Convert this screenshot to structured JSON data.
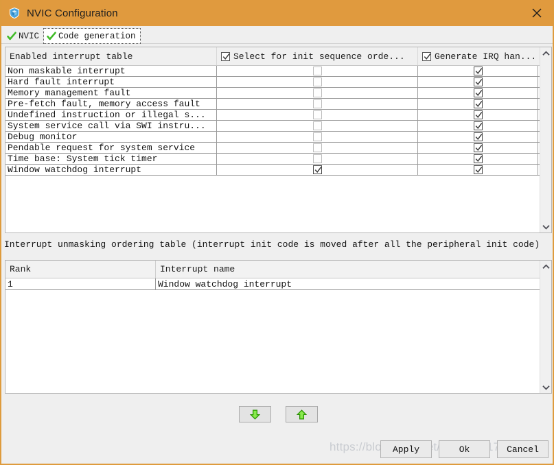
{
  "window": {
    "title": "NVIC Configuration",
    "icon": "shield-cube-icon",
    "close_label": "✕",
    "titlebar_color": "#e09a3e",
    "border_color": "#de9b3d"
  },
  "tabs": [
    {
      "label": "NVIC",
      "icon": "green-check-icon",
      "active": false
    },
    {
      "label": "Code generation",
      "icon": "green-check-icon",
      "active": true
    }
  ],
  "interrupt_table": {
    "columns": [
      {
        "key": "name",
        "label": "Enabled interrupt table",
        "has_checkbox": false
      },
      {
        "key": "select",
        "label": "Select for init sequence orde...",
        "has_checkbox": true,
        "checked": true
      },
      {
        "key": "irq",
        "label": "Generate IRQ han...",
        "has_checkbox": true,
        "checked": true
      }
    ],
    "rows": [
      {
        "name": "Non maskable interrupt",
        "select": false,
        "select_enabled": false,
        "irq": true
      },
      {
        "name": "Hard fault interrupt",
        "select": false,
        "select_enabled": false,
        "irq": true
      },
      {
        "name": "Memory management fault",
        "select": false,
        "select_enabled": false,
        "irq": true
      },
      {
        "name": "Pre-fetch fault, memory access fault",
        "select": false,
        "select_enabled": false,
        "irq": true
      },
      {
        "name": "Undefined instruction or illegal s...",
        "select": false,
        "select_enabled": false,
        "irq": true
      },
      {
        "name": "System service call via SWI instru...",
        "select": false,
        "select_enabled": false,
        "irq": true
      },
      {
        "name": "Debug monitor",
        "select": false,
        "select_enabled": false,
        "irq": true
      },
      {
        "name": "Pendable request for system service",
        "select": false,
        "select_enabled": false,
        "irq": true
      },
      {
        "name": "Time base: System tick timer",
        "select": false,
        "select_enabled": false,
        "irq": true
      },
      {
        "name": "Window watchdog interrupt",
        "select": true,
        "select_enabled": true,
        "irq": true
      }
    ]
  },
  "ordering": {
    "caption": "Interrupt unmasking ordering table (interrupt init code is moved after all the peripheral init code)",
    "columns": [
      "Rank",
      "Interrupt name"
    ],
    "rows": [
      {
        "rank": "1",
        "name": "Window watchdog interrupt"
      }
    ]
  },
  "move_buttons": [
    {
      "name": "move-down-button",
      "icon": "green-arrow-down-icon"
    },
    {
      "name": "move-up-button",
      "icon": "green-arrow-up-icon"
    }
  ],
  "footer": {
    "apply_label": "Apply",
    "ok_label": "Ok",
    "cancel_label": "Cancel"
  },
  "watermark": "https://blog.csdn.net/weixin_41738734"
}
